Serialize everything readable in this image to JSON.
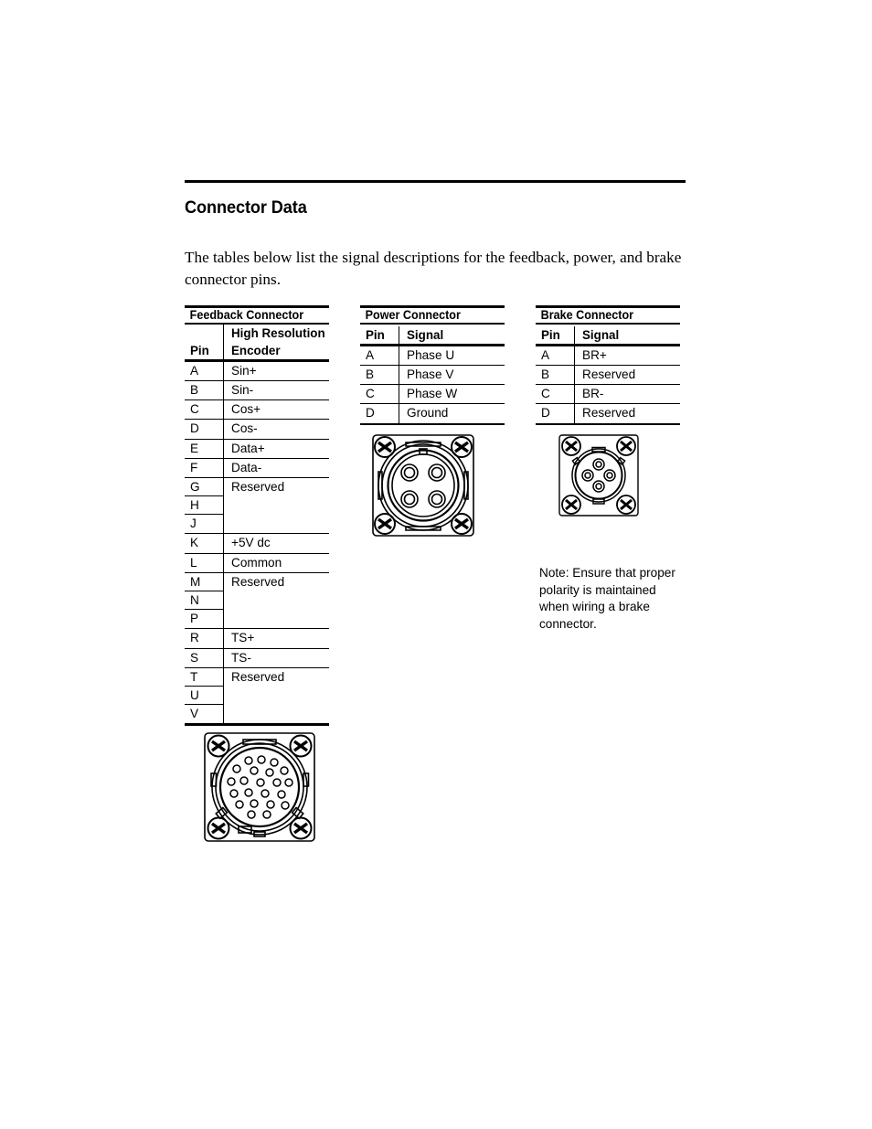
{
  "document": {
    "heading": "Connector Data",
    "intro": "The tables below list the signal descriptions for the feedback, power, and brake connector pins."
  },
  "feedback_table": {
    "title": "Feedback Connector",
    "header": {
      "pin": "Pin",
      "signal_line1": "High Resolution",
      "signal_line2": "Encoder"
    },
    "rows": [
      {
        "pin": "A",
        "signal": "Sin+"
      },
      {
        "pin": "B",
        "signal": "Sin-"
      },
      {
        "pin": "C",
        "signal": "Cos+"
      },
      {
        "pin": "D",
        "signal": "Cos-"
      },
      {
        "pin": "E",
        "signal": "Data+"
      },
      {
        "pin": "F",
        "signal": "Data-"
      }
    ],
    "group1": {
      "pins": [
        "G",
        "H",
        "J"
      ],
      "signal": "Reserved"
    },
    "rows2": [
      {
        "pin": "K",
        "signal": "+5V dc"
      },
      {
        "pin": "L",
        "signal": "Common"
      }
    ],
    "group2": {
      "pins": [
        "M",
        "N",
        "P"
      ],
      "signal": "Reserved"
    },
    "rows3": [
      {
        "pin": "R",
        "signal": "TS+"
      },
      {
        "pin": "S",
        "signal": "TS-"
      }
    ],
    "group3": {
      "pins": [
        "T",
        "U",
        "V"
      ],
      "signal": "Reserved"
    }
  },
  "power_table": {
    "title": "Power Connector",
    "header": {
      "pin": "Pin",
      "signal": "Signal"
    },
    "rows": [
      {
        "pin": "A",
        "signal": "Phase U"
      },
      {
        "pin": "B",
        "signal": "Phase V"
      },
      {
        "pin": "C",
        "signal": "Phase W"
      },
      {
        "pin": "D",
        "signal": "Ground"
      }
    ]
  },
  "brake_table": {
    "title": "Brake Connector",
    "header": {
      "pin": "Pin",
      "signal": "Signal"
    },
    "rows": [
      {
        "pin": "A",
        "signal": "BR+"
      },
      {
        "pin": "B",
        "signal": "Reserved"
      },
      {
        "pin": "C",
        "signal": "BR-"
      },
      {
        "pin": "D",
        "signal": "Reserved"
      }
    ]
  },
  "brake_note": "Note: Ensure that proper polarity is maintained when wiring a brake connector.",
  "diagrams": {
    "feedback": {
      "name": "feedback-connector-pinout",
      "pin_count": 22
    },
    "power": {
      "name": "power-connector-pinout",
      "pin_count": 4
    },
    "brake": {
      "name": "brake-connector-pinout",
      "pin_count": 4
    }
  },
  "colors": {
    "ink": "#000000",
    "paper": "#ffffff"
  }
}
